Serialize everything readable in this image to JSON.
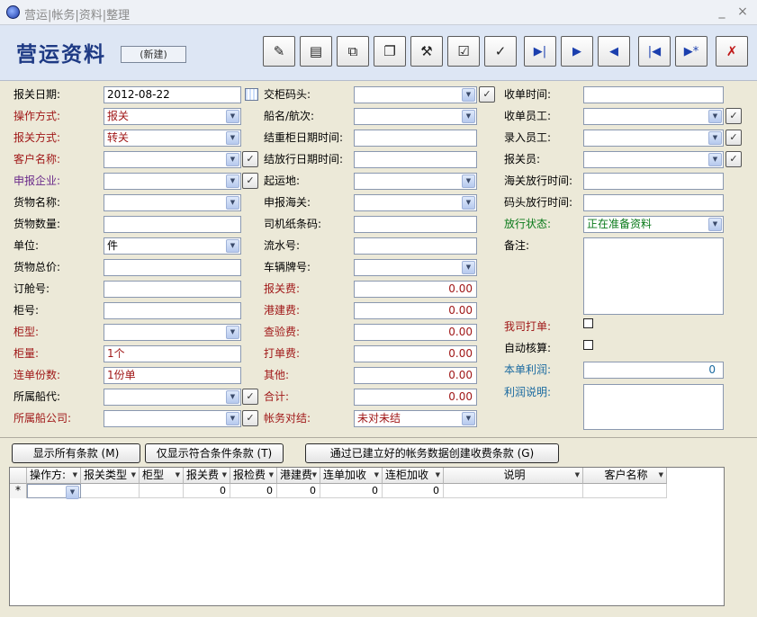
{
  "window": {
    "title": "营运|帐务|资料|整理",
    "minimize": "_",
    "close": "×"
  },
  "header": {
    "title": "营运资料",
    "mode": "(新建)"
  },
  "toolbar": [
    {
      "name": "edit-icon",
      "glyph": "✎"
    },
    {
      "name": "properties-icon",
      "glyph": "▤"
    },
    {
      "name": "copy-icon",
      "glyph": "⧉"
    },
    {
      "name": "copy-all-icon",
      "glyph": "❐"
    },
    {
      "name": "tools-icon",
      "glyph": "⚒"
    },
    {
      "name": "clipboard-check-icon",
      "glyph": "☑"
    },
    {
      "name": "filter-check-icon",
      "glyph": "✓"
    },
    {
      "name": "next-end-icon",
      "glyph": "▶|"
    },
    {
      "name": "next-icon",
      "glyph": "▶"
    },
    {
      "name": "prev-icon",
      "glyph": "◀"
    },
    {
      "name": "first-icon",
      "glyph": "|◀"
    },
    {
      "name": "new-record-icon",
      "glyph": "▶*"
    },
    {
      "name": "close-red-icon",
      "glyph": "✗"
    }
  ],
  "col1": {
    "date_label": "报关日期:",
    "date_value": "2012-08-22",
    "op_mode_label": "操作方式:",
    "op_mode_value": "报关",
    "customs_mode_label": "报关方式:",
    "customs_mode_value": "转关",
    "customer_label": "客户名称:",
    "customer_value": "",
    "declarer_label": "申报企业:",
    "declarer_value": "",
    "goods_name_label": "货物名称:",
    "goods_name_value": "",
    "goods_qty_label": "货物数量:",
    "goods_qty_value": "",
    "unit_label": "单位:",
    "unit_value": "件",
    "goods_total_label": "货物总价:",
    "goods_total_value": "",
    "booking_label": "订舱号:",
    "booking_value": "",
    "container_no_label": "柜号:",
    "container_no_value": "",
    "container_type_label": "柜型:",
    "container_type_value": "",
    "container_qty_label": "柜量:",
    "container_qty_value": "1个",
    "bill_copies_label": "连单份数:",
    "bill_copies_value": "1份单",
    "agent_label": "所属船代:",
    "agent_value": "",
    "ship_company_label": "所属船公司:",
    "ship_company_value": ""
  },
  "col2": {
    "terminal_label": "交柜码头:",
    "terminal_value": "",
    "vessel_label": "船名/航次:",
    "vessel_value": "",
    "reweigh_label": "结重柜日期时间:",
    "reweigh_value": "",
    "release_label": "结放行日期时间:",
    "release_value": "",
    "origin_label": "起运地:",
    "origin_value": "",
    "customs_label": "申报海关:",
    "customs_value": "",
    "driver_label": "司机纸条码:",
    "driver_value": "",
    "serial_label": "流水号:",
    "serial_value": "",
    "plate_label": "车辆牌号:",
    "plate_value": "",
    "fee_customs_label": "报关费:",
    "fee_customs_value": "0.00",
    "fee_port_label": "港建费:",
    "fee_port_value": "0.00",
    "fee_inspect_label": "查验费:",
    "fee_inspect_value": "0.00",
    "fee_print_label": "打单费:",
    "fee_print_value": "0.00",
    "fee_other_label": "其他:",
    "fee_other_value": "0.00",
    "total_label": "合计:",
    "total_value": "0.00",
    "recon_label": "帐务对结:",
    "recon_value": "未对未结"
  },
  "col3": {
    "receive_time_label": "收单时间:",
    "receive_time_value": "",
    "receive_staff_label": "收单员工:",
    "receive_staff_value": "",
    "entry_staff_label": "录入员工:",
    "entry_staff_value": "",
    "declarant_label": "报关员:",
    "declarant_value": "",
    "customs_release_label": "海关放行时间:",
    "customs_release_value": "",
    "terminal_release_label": "码头放行时间:",
    "terminal_release_value": "",
    "release_status_label": "放行状态:",
    "release_status_value": "正在准备资料",
    "remarks_label": "备注:",
    "self_print_label": "我司打单:",
    "auto_check_label": "自动核算:",
    "profit_label": "本单利润:",
    "profit_value": "0",
    "profit_note_label": "利润说明:"
  },
  "actions": {
    "show_all": "显示所有条款 (M)",
    "show_match": "仅显示符合条件条款 (T)",
    "create_fees": "通过已建立好的帐务数据创建收费条款 (G)"
  },
  "grid": {
    "headers": [
      "操作方:",
      "报关类型",
      "柜型",
      "报关费",
      "报检费",
      "港建费",
      "连单加收",
      "连柜加收",
      "说明",
      "客户名称"
    ],
    "new_row_marker": "*",
    "new_row": [
      "",
      "",
      "",
      "0",
      "0",
      "0",
      "0",
      "0",
      "",
      ""
    ]
  }
}
